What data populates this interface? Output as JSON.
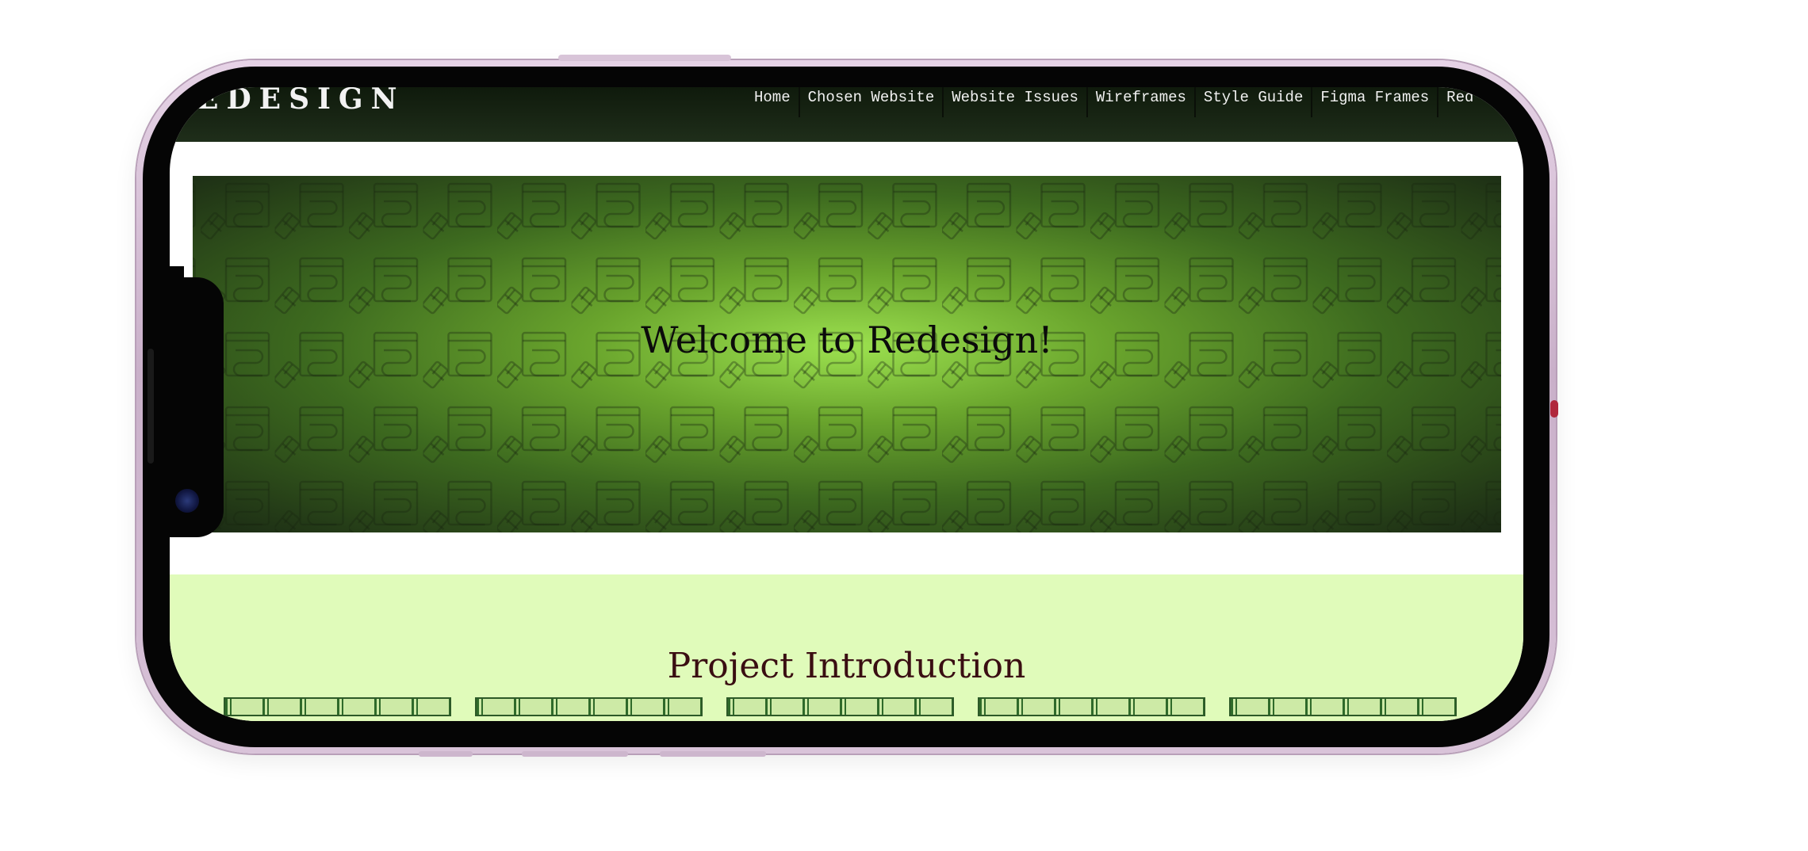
{
  "navbar": {
    "logo": "EDESIGN",
    "items": [
      "Home",
      "Chosen Website",
      "Website Issues",
      "Wireframes",
      "Style Guide",
      "Figma Frames",
      "Red"
    ]
  },
  "hero": {
    "title": "Welcome to Redesign!"
  },
  "intro": {
    "title": "Project Introduction"
  },
  "colors": {
    "navbar": "#1a2815",
    "hero_center": "#9ce14f",
    "hero_edge": "#1a2914",
    "intro_bg": "#e0fbba",
    "intro_title": "#3a0e12"
  }
}
